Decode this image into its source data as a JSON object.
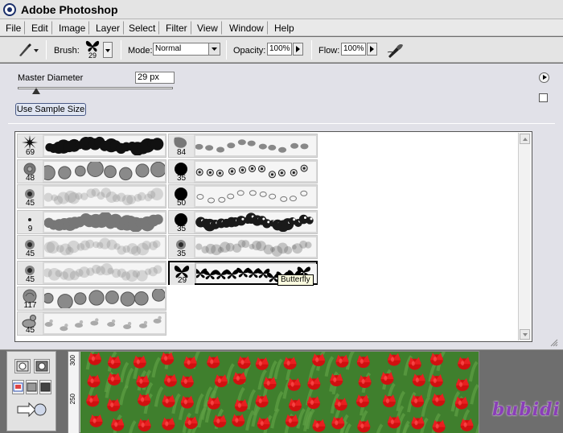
{
  "window": {
    "title": "Adobe Photoshop"
  },
  "menu": [
    "File",
    "Edit",
    "Image",
    "Layer",
    "Select",
    "Filter",
    "View",
    "Window",
    "Help"
  ],
  "options": {
    "brush_label": "Brush:",
    "brush_size": "29",
    "mode_label": "Mode:",
    "mode_value": "Normal",
    "opacity_label": "Opacity:",
    "opacity_value": "100%",
    "flow_label": "Flow:",
    "flow_value": "100%"
  },
  "brushes_panel": {
    "master_diameter_label": "Master Diameter",
    "master_diameter_value": "29 px",
    "master_diameter_fraction": 0.12,
    "sample_button": "Use Sample Size",
    "left_column": [
      {
        "size": "69",
        "tip": "starburst",
        "stroke": "dark-spiky"
      },
      {
        "size": "48",
        "tip": "flower",
        "stroke": "rose-clusters"
      },
      {
        "size": "45",
        "tip": "soft-dot",
        "stroke": "soft-foliage"
      },
      {
        "size": "9",
        "tip": "small-dot",
        "stroke": "grey-mass"
      },
      {
        "size": "45",
        "tip": "soft-dot",
        "stroke": "soft-foliage"
      },
      {
        "size": "45",
        "tip": "soft-dot",
        "stroke": "soft-leaves"
      },
      {
        "size": "117",
        "tip": "rose",
        "stroke": "rose-clusters"
      },
      {
        "size": "45",
        "tip": "duck",
        "stroke": "ducks"
      }
    ],
    "right_column": [
      {
        "size": "84",
        "tip": "leaf",
        "stroke": "leaves"
      },
      {
        "size": "35",
        "tip": "hard-dot",
        "stroke": "spirals"
      },
      {
        "size": "50",
        "tip": "hard-dot",
        "stroke": "outline-leaves"
      },
      {
        "size": "35",
        "tip": "hard-dot",
        "stroke": "dark-splatter"
      },
      {
        "size": "35",
        "tip": "soft-dot",
        "stroke": "soft-splatter"
      },
      {
        "size": "29",
        "tip": "butterfly",
        "stroke": "butterflies",
        "selected": true
      }
    ],
    "tooltip": "Butterfly"
  },
  "ruler_labels": [
    "300",
    "250"
  ],
  "watermark": "bubidi",
  "colors": {
    "title_bg": "#e4e4e4",
    "panel_bg": "#e1e1e8",
    "workspace": "#6e6e6e",
    "tulip_red": "#d01010",
    "leaf_green": "#3f7f2d",
    "watermark": "#8a3fb8"
  }
}
